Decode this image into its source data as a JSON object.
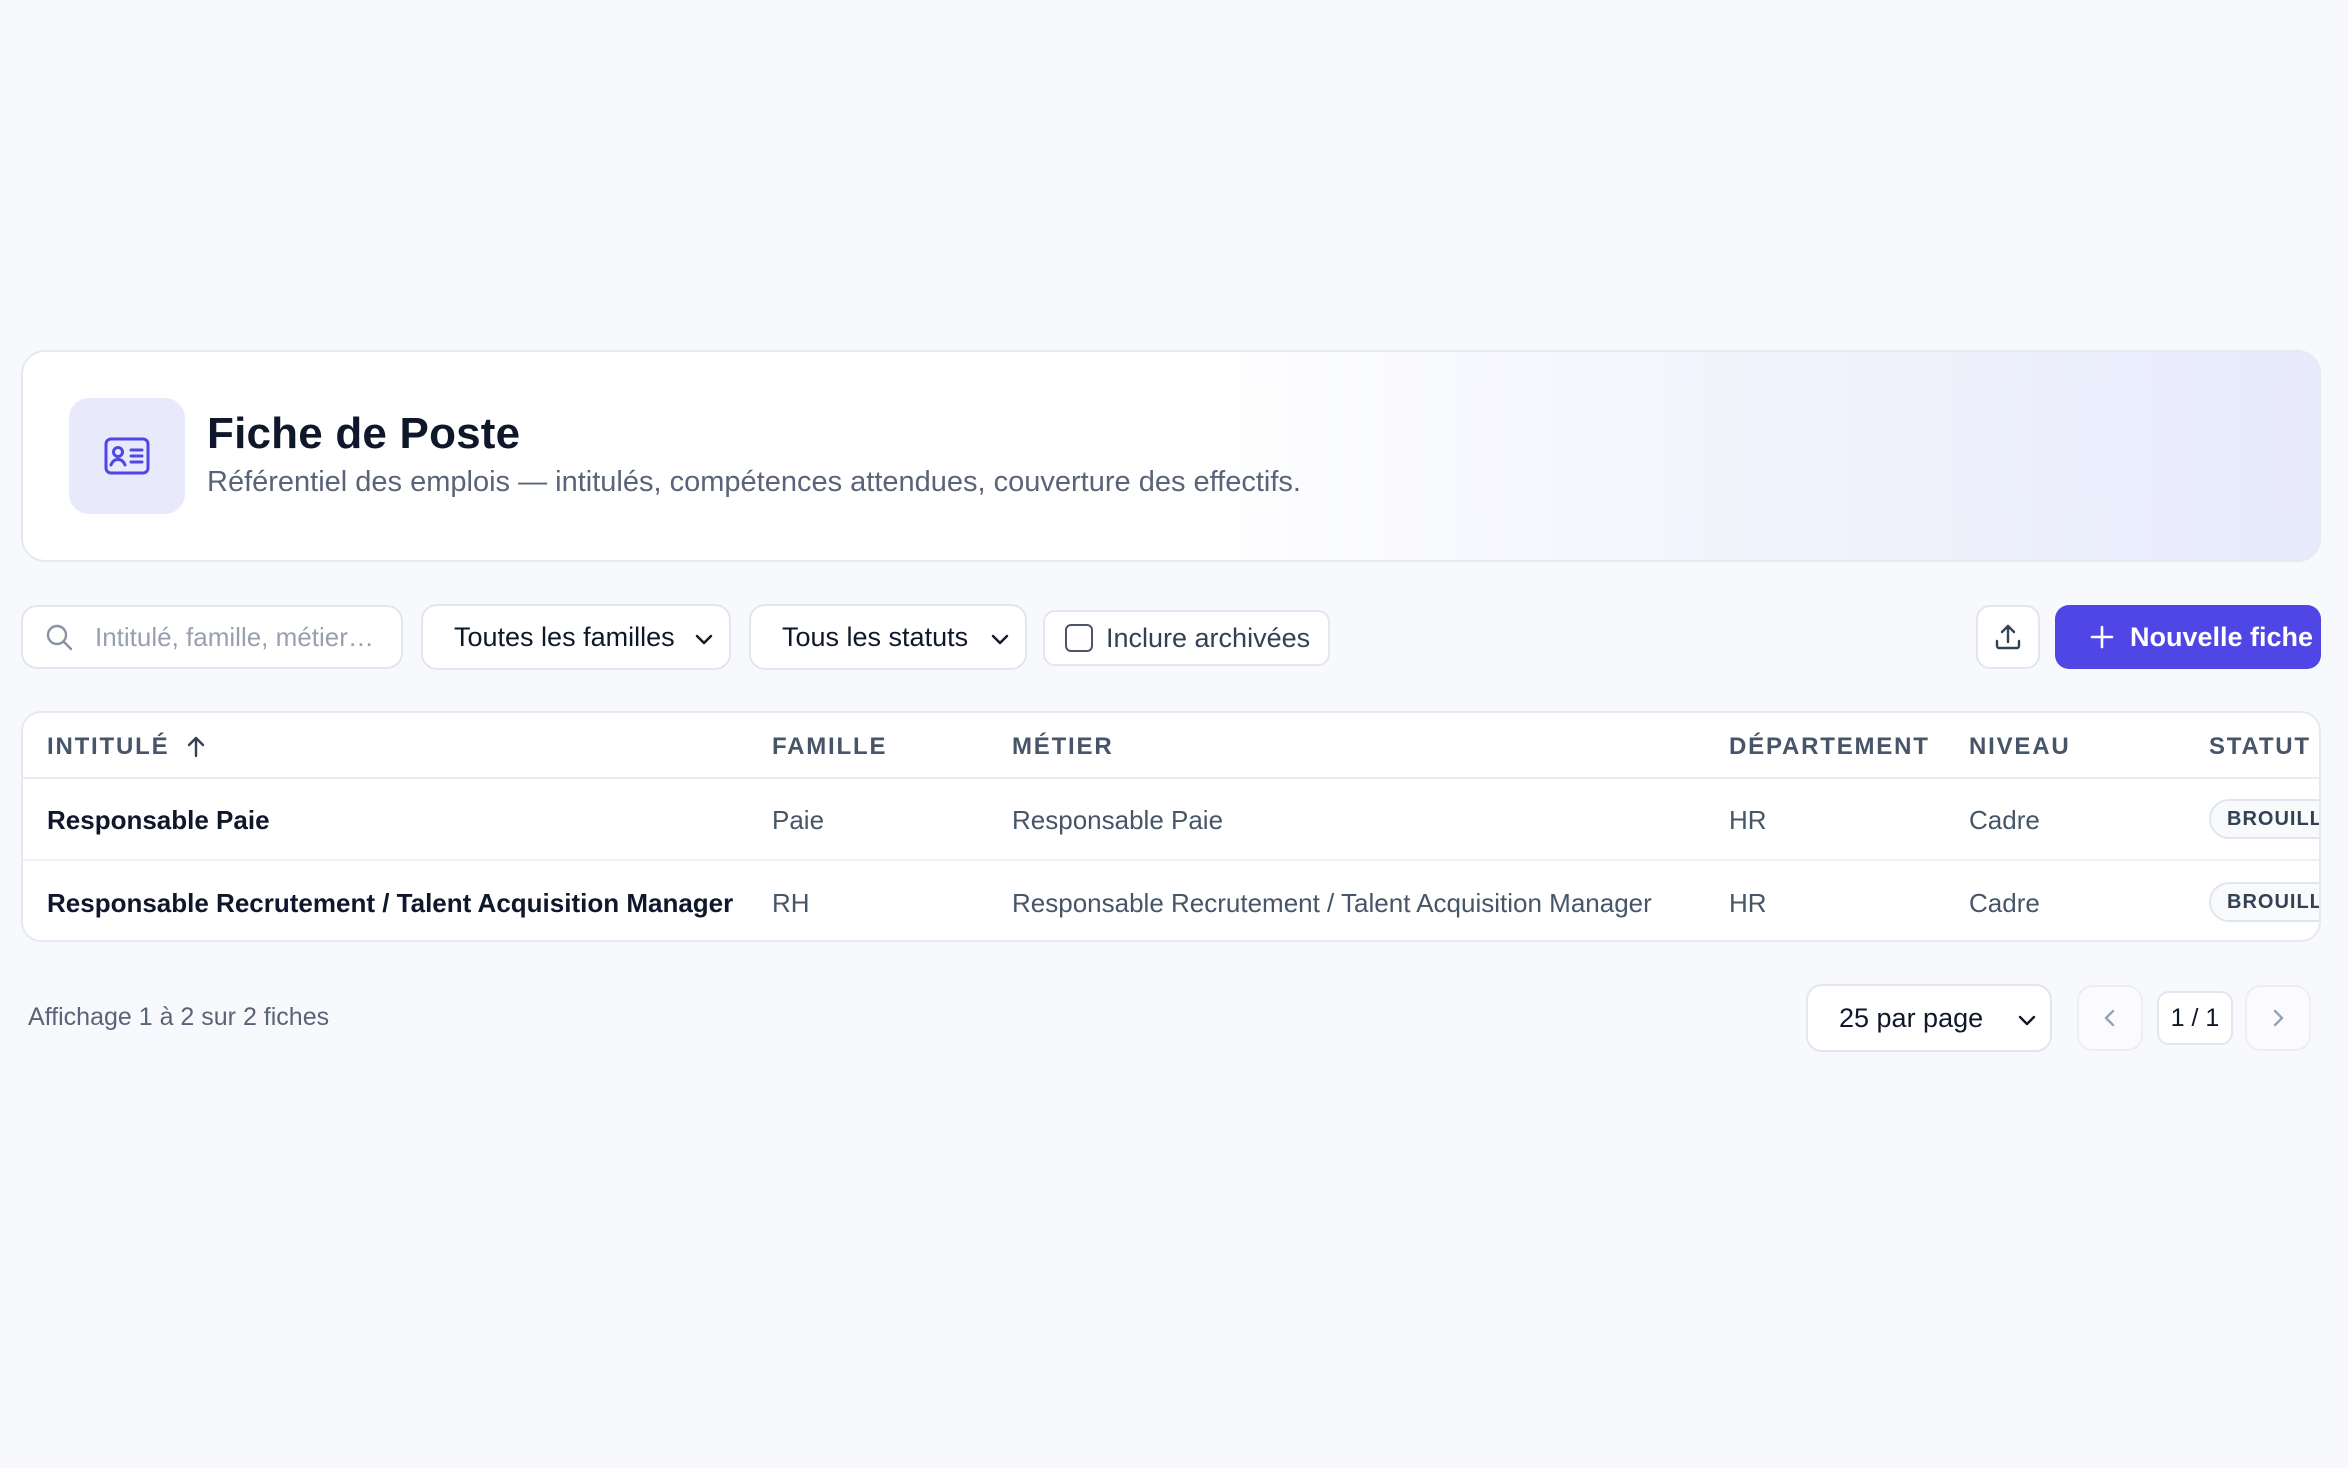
{
  "header": {
    "icon": "id-card-icon",
    "title": "Fiche de Poste",
    "subtitle": "Référentiel des emplois — intitulés, compétences attendues, couverture des effectifs."
  },
  "toolbar": {
    "search_placeholder": "Intitulé, famille, métier…",
    "family_filter": "Toutes les familles",
    "status_filter": "Tous les statuts",
    "include_archived_label": "Inclure archivées",
    "include_archived_checked": false,
    "export_icon": "upload-icon",
    "new_button_label": "Nouvelle fiche"
  },
  "table": {
    "columns": [
      "INTITULÉ",
      "FAMILLE",
      "MÉTIER",
      "DÉPARTEMENT",
      "NIVEAU",
      "STATUT"
    ],
    "sort_column": "INTITULÉ",
    "sort_direction": "asc",
    "rows": [
      {
        "intitule": "Responsable Paie",
        "famille": "Paie",
        "metier": "Responsable Paie",
        "departement": "HR",
        "niveau": "Cadre",
        "statut": "BROUILLO"
      },
      {
        "intitule": "Responsable Recrutement / Talent Acquisition Manager",
        "famille": "RH",
        "metier": "Responsable Recrutement / Talent Acquisition Manager",
        "departement": "HR",
        "niveau": "Cadre",
        "statut": "BROUILLO"
      }
    ]
  },
  "footer": {
    "info": "Affichage 1 à 2 sur 2 fiches",
    "per_page": "25 par page",
    "page_indicator": "1 / 1"
  },
  "colors": {
    "accent": "#4f46e5",
    "background": "#f8f9fc",
    "text_primary": "#0f172a",
    "text_muted": "#5a6478"
  }
}
